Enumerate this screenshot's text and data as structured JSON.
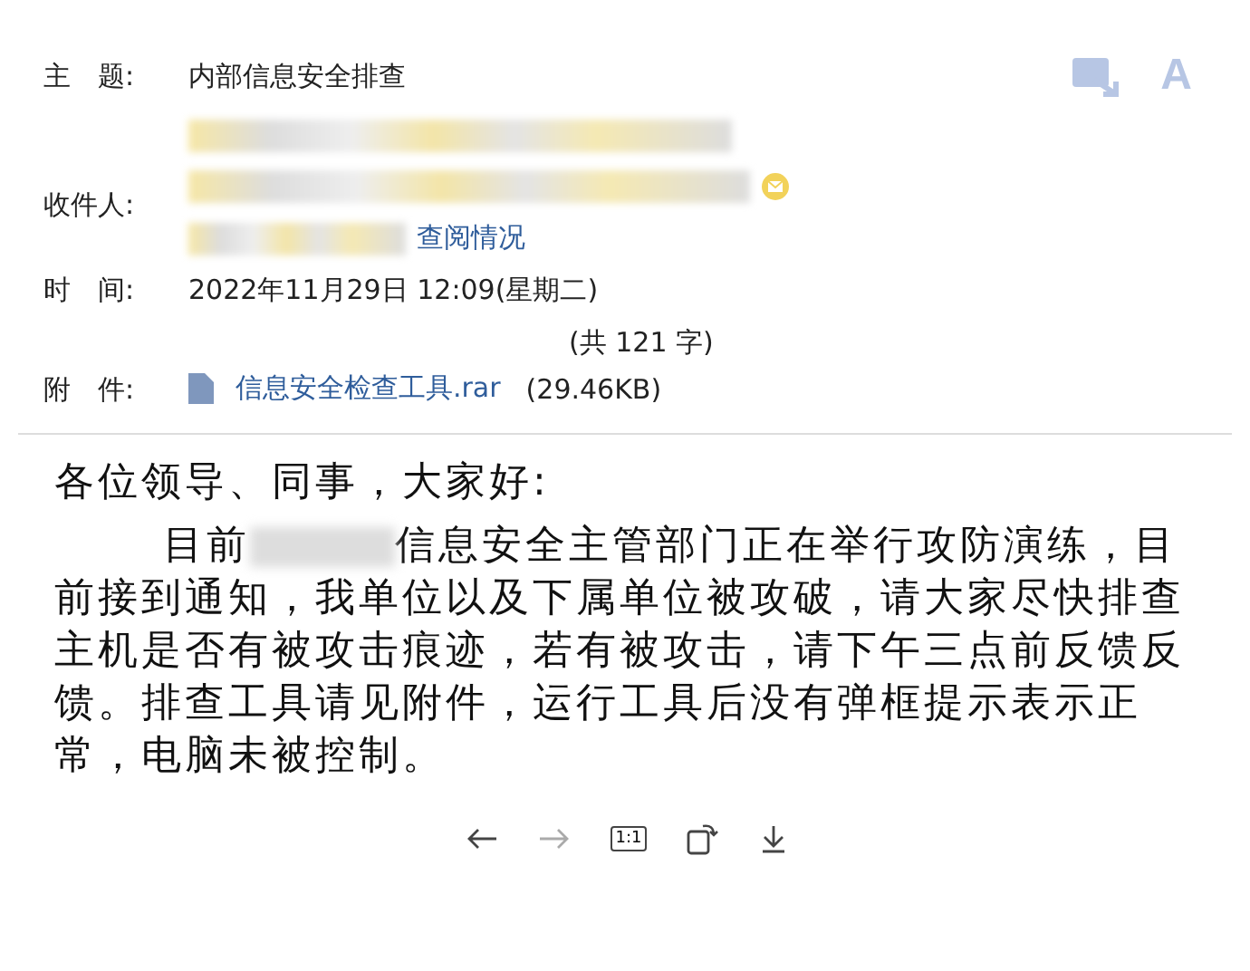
{
  "header": {
    "subject_label": "主　题:",
    "subject": "内部信息安全排查",
    "font_button": "A",
    "recipients_label": "收件人:",
    "read_status_link": "查阅情况",
    "time_label": "时　间:",
    "time": "2022年11月29日 12:09(星期二)",
    "char_count": "(共 121 字)",
    "attachment_label": "附　件:",
    "attachment": {
      "name": "信息安全检查工具.rar",
      "size": "(29.46KB)"
    }
  },
  "body": {
    "greeting": "各位领导、同事，大家好:",
    "paragraph_start": "目前",
    "paragraph_rest": "信息安全主管部门正在举行攻防演练，目前接到通知，我单位以及下属单位被攻破，请大家尽快排查主机是否有被攻击痕迹，若有被攻击，请下午三点前反馈反馈。排查工具请见附件，运行工具后没有弹框提示表示正常，电脑未被控制。"
  },
  "toolbar": {
    "actual_size": "1:1"
  }
}
